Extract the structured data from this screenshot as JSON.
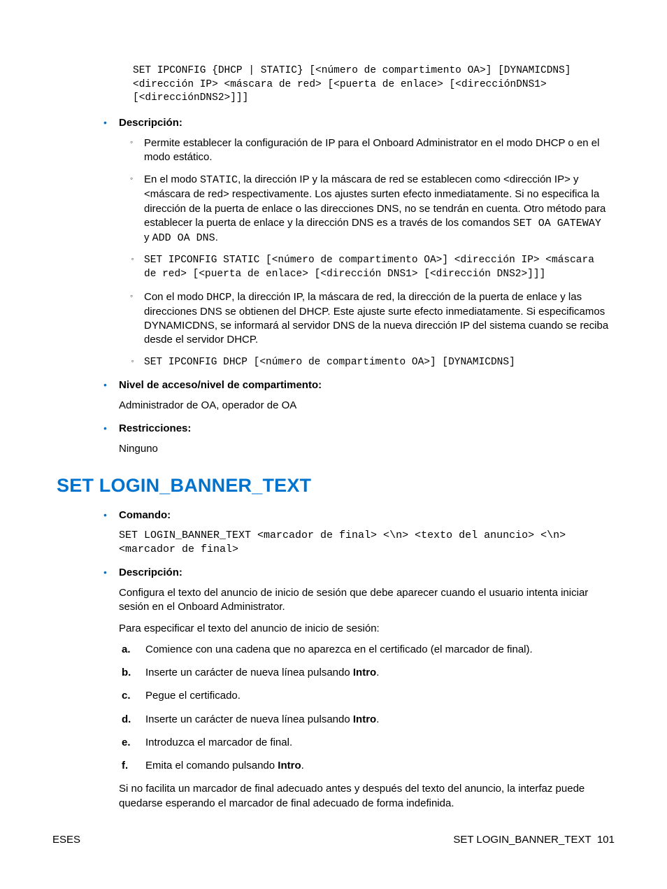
{
  "topCode": "SET IPCONFIG {DHCP | STATIC} [<número de compartimento OA>] [DYNAMICDNS] <dirección IP> <máscara de red> [<puerta de enlace> [<direcciónDNS1> [<direcciónDNS2>]]]",
  "sec1": {
    "descLabel": "Descripción:",
    "d1": "Permite establecer la configuración de IP para el Onboard Administrator en el modo DHCP o en el modo estático.",
    "d2_a": "En el modo ",
    "d2_static": "STATIC",
    "d2_b": ", la dirección IP y la máscara de red se establecen como <dirección IP> y <máscara de red> respectivamente. Los ajustes surten efecto inmediatamente. Si no especifica la dirección de la puerta de enlace o las direcciones DNS, no se tendrán en cuenta. Otro método para establecer la puerta de enlace y la dirección DNS es a través de los comandos ",
    "d2_cmd1": "SET OA GATEWAY",
    "d2_y": " y ",
    "d2_cmd2": "ADD OA DNS",
    "d2_end": ".",
    "d3": "SET IPCONFIG STATIC [<número de compartimento OA>] <dirección IP> <máscara de red> [<puerta de enlace> [<dirección DNS1> [<dirección DNS2>]]]",
    "d4_a": "Con el modo ",
    "d4_dhcp": "DHCP",
    "d4_b": ", la dirección IP, la máscara de red, la dirección de la puerta de enlace y las direcciones DNS se obtienen del DHCP. Este ajuste surte efecto inmediatamente. Si especificamos DYNAMICDNS, se informará al servidor DNS de la nueva dirección IP del sistema cuando se reciba desde el servidor DHCP.",
    "d5": "SET IPCONFIG DHCP [<número de compartimento OA>] [DYNAMICDNS]",
    "accessLabel": "Nivel de acceso/nivel de compartimento:",
    "accessBody": "Administrador de OA, operador de OA",
    "restrLabel": "Restricciones:",
    "restrBody": "Ninguno"
  },
  "heading": "SET LOGIN_BANNER_TEXT",
  "sec2": {
    "cmdLabel": "Comando:",
    "cmdCode": "SET LOGIN_BANNER_TEXT <marcador de final> <\\n> <texto del anuncio> <\\n> <marcador de final>",
    "descLabel": "Descripción:",
    "descBody": "Configura el texto del anuncio de inicio de sesión que debe aparecer cuando el usuario intenta iniciar sesión en el Onboard Administrator.",
    "intro": "Para especificar el texto del anuncio de inicio de sesión:",
    "steps": {
      "a": "Comience con una cadena que no aparezca en el certificado (el marcador de final).",
      "b_a": "Inserte un carácter de nueva línea pulsando ",
      "b_b": "Intro",
      "b_c": ".",
      "c": "Pegue el certificado.",
      "d_a": "Inserte un carácter de nueva línea pulsando ",
      "d_b": "Intro",
      "d_c": ".",
      "e": "Introduzca el marcador de final.",
      "f_a": "Emita el comando pulsando ",
      "f_b": "Intro",
      "f_c": "."
    },
    "note": "Si no facilita un marcador de final adecuado antes y después del texto del anuncio, la interfaz puede quedarse esperando el marcador de final adecuado de forma indefinida."
  },
  "footer": {
    "left": "ESES",
    "rightLabel": "SET LOGIN_BANNER_TEXT",
    "page": "101"
  }
}
